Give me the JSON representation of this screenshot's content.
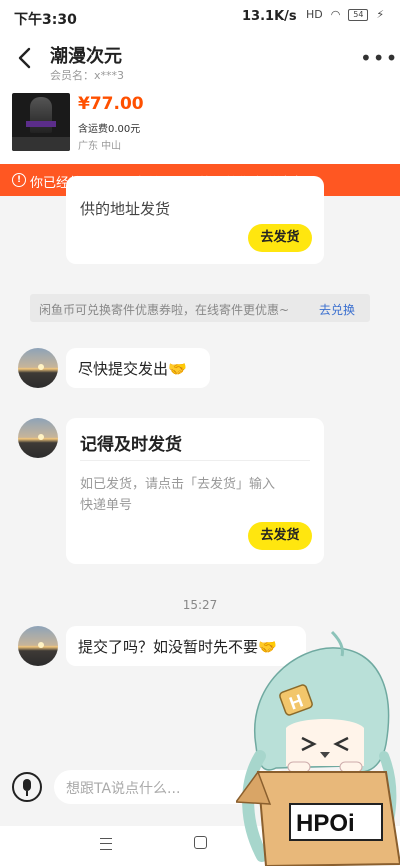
{
  "status_bar": {
    "time": "下午3:30",
    "net_speed": "13.1K/s",
    "battery": "54"
  },
  "header": {
    "title": "潮漫次元",
    "member": "会员名：x***3"
  },
  "product": {
    "price": "¥77.00",
    "shipping": "含运费0.00元",
    "location": "广东 中山"
  },
  "banner": {
    "text": "你已经将ta加入黑名单，ta不能再给你发送消息"
  },
  "messages": {
    "card1_partial": "供的地址发货",
    "card1_button": "去发货",
    "notice_text": "闲鱼币可兑换寄件优惠券啦，在线寄件更优惠~",
    "notice_link": "去兑换",
    "bubble1": "尽快提交发出🤝",
    "card2_title": "记得及时发货",
    "card2_body_line1": "如已发货，请点击「去发货」输入",
    "card2_body_line2": "快递单号",
    "card2_button": "去发货",
    "timestamp": "15:27",
    "bubble2": "提交了吗？如没暂时先不要🤝"
  },
  "input": {
    "placeholder": "想跟TA说点什么..."
  },
  "mascot": {
    "brand": "HPOi"
  },
  "colors": {
    "accent_orange": "#ff5722",
    "price": "#ff5000",
    "button_yellow": "#ffe60f",
    "link_blue": "#3a6fcf"
  }
}
